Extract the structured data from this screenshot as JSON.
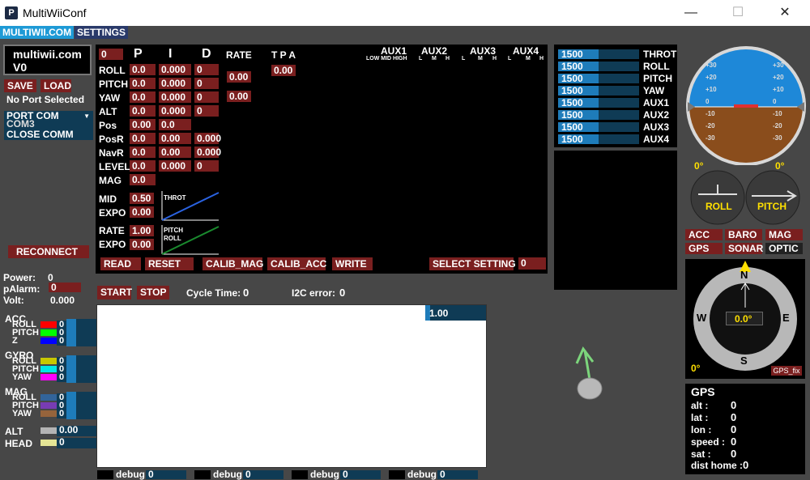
{
  "window": {
    "app_icon": "P",
    "title": "MultiWiiConf",
    "minimize": "—",
    "maximize": "☐",
    "close": "✕"
  },
  "tabs": {
    "site": "MULTIWII.COM",
    "settings": "SETTINGS"
  },
  "left": {
    "logo_line1": "multiwii.com",
    "logo_line2": "V0",
    "save": "SAVE",
    "load": "LOAD",
    "port_status": "No Port Selected",
    "port_com": "PORT COM",
    "com3": "COM3",
    "close_comm": "CLOSE COMM",
    "reconnect": "RECONNECT",
    "power_label": "Power:",
    "power_value": "0",
    "palarm_label": "pAlarm:",
    "palarm_value": "0",
    "volt_label": "Volt:",
    "volt_value": "0.000"
  },
  "pid": {
    "profile": "0",
    "headers": {
      "p": "P",
      "i": "I",
      "d": "D",
      "rate": "RATE",
      "tpa": "T P A"
    },
    "rows": [
      {
        "name": "ROLL",
        "p": "0.0",
        "i": "0.000",
        "d": "0"
      },
      {
        "name": "PITCH",
        "p": "0.0",
        "i": "0.000",
        "d": "0"
      },
      {
        "name": "YAW",
        "p": "0.0",
        "i": "0.000",
        "d": "0"
      },
      {
        "name": "ALT",
        "p": "0.0",
        "i": "0.000",
        "d": "0"
      },
      {
        "name": "Pos",
        "p": "0.00",
        "i": "0.0",
        "d": ""
      },
      {
        "name": "PosR",
        "p": "0.0",
        "i": "0.00",
        "d": "0.000"
      },
      {
        "name": "NavR",
        "p": "0.0",
        "i": "0.00",
        "d": "0.000"
      },
      {
        "name": "LEVEL",
        "p": "0.0",
        "i": "0.000",
        "d": "0"
      },
      {
        "name": "MAG",
        "p": "0.0",
        "i": "",
        "d": ""
      }
    ],
    "rate_roll_pitch": "0.00",
    "rate_yaw": "0.00",
    "tpa": "0.00",
    "mid_label": "MID",
    "mid_value": "0.50",
    "expo_label": "EXPO",
    "expo_value": "0.00",
    "throt_label": "THROT",
    "rate_label": "RATE",
    "rate_value": "1.00",
    "expo2_label": "EXPO",
    "expo2_value": "0.00",
    "pitch_roll_label1": "PITCH",
    "pitch_roll_label2": "ROLL",
    "aux_headers": [
      "AUX1",
      "AUX2",
      "AUX3",
      "AUX4"
    ],
    "aux1_sub": "LOW MID HIGH",
    "aux_sub": [
      "L",
      "M",
      "H"
    ],
    "buttons": {
      "read": "READ",
      "reset": "RESET",
      "calib_mag": "CALIB_MAG",
      "calib_acc": "CALIB_ACC",
      "write": "WRITE",
      "select_setting": "SELECT SETTING",
      "setting_value": "0"
    }
  },
  "rc": [
    {
      "value": "1500",
      "name": "THROT",
      "fill": 0.5
    },
    {
      "value": "1500",
      "name": "ROLL",
      "fill": 0.5
    },
    {
      "value": "1500",
      "name": "PITCH",
      "fill": 0.5
    },
    {
      "value": "1500",
      "name": "YAW",
      "fill": 0.5
    },
    {
      "value": "1500",
      "name": "AUX1",
      "fill": 0.5
    },
    {
      "value": "1500",
      "name": "AUX2",
      "fill": 0.5
    },
    {
      "value": "1500",
      "name": "AUX3",
      "fill": 0.5
    },
    {
      "value": "1500",
      "name": "AUX4",
      "fill": 0.5
    }
  ],
  "graph": {
    "start": "START",
    "stop": "STOP",
    "cycle_label": "Cycle Time:",
    "cycle_value": "0",
    "i2c_label": "I2C error:",
    "i2c_value": "0",
    "scale": "1.00"
  },
  "sensors": {
    "acc": "ACC",
    "gyro": "GYRO",
    "mag": "MAG",
    "alt": "ALT",
    "head": "HEAD",
    "acc_rows": [
      {
        "name": "ROLL",
        "color": "#ff0000",
        "value": "0"
      },
      {
        "name": "PITCH",
        "color": "#00ff00",
        "value": "0"
      },
      {
        "name": "Z",
        "color": "#0000ff",
        "value": "0"
      }
    ],
    "gyro_rows": [
      {
        "name": "ROLL",
        "color": "#c8c800",
        "value": "0"
      },
      {
        "name": "PITCH",
        "color": "#00e6e6",
        "value": "0"
      },
      {
        "name": "YAW",
        "color": "#ff00ff",
        "value": "0"
      }
    ],
    "mag_rows": [
      {
        "name": "ROLL",
        "color": "#32649a",
        "value": "0"
      },
      {
        "name": "PITCH",
        "color": "#783cb4",
        "value": "0"
      },
      {
        "name": "YAW",
        "color": "#96643c",
        "value": "0"
      }
    ],
    "alt_value": "0.00",
    "alt_color": "#b4b4b4",
    "head_value": "0",
    "head_color": "#e6e696"
  },
  "debug": [
    {
      "label": "debug",
      "value": "0"
    },
    {
      "label": "debug",
      "value": "0"
    },
    {
      "label": "debug",
      "value": "0"
    },
    {
      "label": "debug",
      "value": "0"
    }
  ],
  "instruments": {
    "horizon_marks": [
      "+30",
      "+20",
      "+10",
      "0",
      "-10",
      "-20",
      "-30"
    ],
    "roll_angle": "0°",
    "pitch_angle": "0°",
    "roll_label": "ROLL",
    "pitch_label": "PITCH",
    "status_badges": [
      "ACC",
      "BARO",
      "MAG",
      "GPS",
      "SONAR",
      "OPTIC"
    ],
    "compass_n": "N",
    "compass_s": "S",
    "compass_e": "E",
    "compass_w": "W",
    "heading": "0.0°",
    "compass_angle": "0°",
    "gps_fix": "GPS_fix"
  },
  "gps": {
    "title": "GPS",
    "rows": [
      {
        "label": "alt   :",
        "value": "0"
      },
      {
        "label": "lat   :",
        "value": "0"
      },
      {
        "label": "lon   :",
        "value": "0"
      },
      {
        "label": "speed :",
        "value": "0"
      },
      {
        "label": "sat   :",
        "value": "0"
      }
    ],
    "dist_home_label": "dist home :",
    "dist_home_value": "0"
  }
}
